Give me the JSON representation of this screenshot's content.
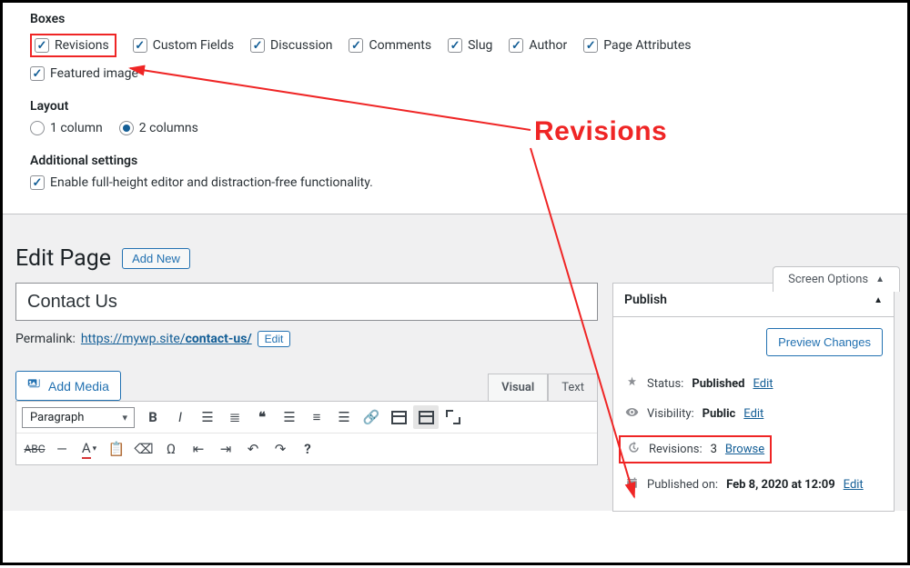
{
  "screen_options": {
    "tab_label": "Screen Options",
    "sections": {
      "boxes": {
        "title": "Boxes",
        "items": [
          {
            "label": "Revisions",
            "checked": true,
            "highlighted": true
          },
          {
            "label": "Custom Fields",
            "checked": true
          },
          {
            "label": "Discussion",
            "checked": true
          },
          {
            "label": "Comments",
            "checked": true
          },
          {
            "label": "Slug",
            "checked": true
          },
          {
            "label": "Author",
            "checked": true
          },
          {
            "label": "Page Attributes",
            "checked": true
          },
          {
            "label": "Featured image",
            "checked": true
          }
        ]
      },
      "layout": {
        "title": "Layout",
        "options": [
          {
            "label": "1 column",
            "selected": false
          },
          {
            "label": "2 columns",
            "selected": true
          }
        ]
      },
      "additional": {
        "title": "Additional settings",
        "items": [
          {
            "label": "Enable full-height editor and distraction-free functionality.",
            "checked": true
          }
        ]
      }
    }
  },
  "page": {
    "heading": "Edit Page",
    "add_new": "Add New",
    "title_value": "Contact Us",
    "permalink_label": "Permalink:",
    "permalink_base": "https://mywp.site/",
    "permalink_slug": "contact-us/",
    "edit_label": "Edit"
  },
  "editor": {
    "add_media": "Add Media",
    "tabs": {
      "visual": "Visual",
      "text": "Text"
    },
    "format_select": "Paragraph"
  },
  "publish": {
    "title": "Publish",
    "preview": "Preview Changes",
    "status_label": "Status:",
    "status_value": "Published",
    "visibility_label": "Visibility:",
    "visibility_value": "Public",
    "revisions_label": "Revisions:",
    "revisions_count": "3",
    "revisions_link": "Browse",
    "published_label": "Published on:",
    "published_value": "Feb 8, 2020 at 12:09",
    "edit_link": "Edit"
  },
  "annotation": {
    "label": "Revisions"
  }
}
